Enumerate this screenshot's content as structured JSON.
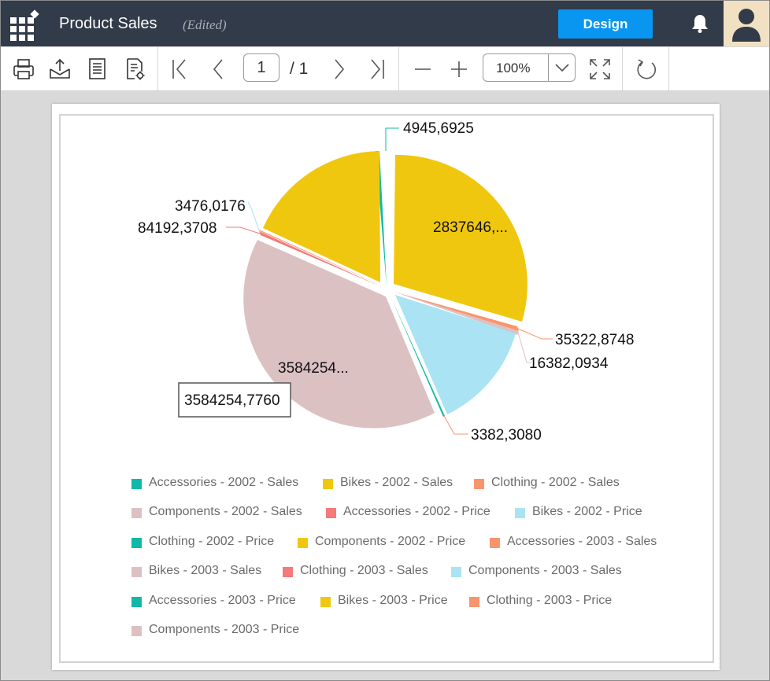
{
  "header": {
    "title": "Product Sales",
    "status": "(Edited)",
    "design_label": "Design"
  },
  "toolbar": {
    "page_value": "1",
    "page_total": "/ 1",
    "zoom": "100%"
  },
  "colors": {
    "teal": "#10b9a6",
    "yellow": "#f0c70f",
    "orange": "#f9956c",
    "pink": "#dcc1c3",
    "red": "#f47a7b",
    "lightblue": "#aae3f3",
    "topbar": "#323b49",
    "accent": "#0896f1"
  },
  "chart_data": {
    "type": "pie",
    "title": "",
    "slices": [
      {
        "series": "Accessories - 2002 - Sales",
        "value": 4945.6925,
        "label": "4945,6925",
        "color": "#10b9a6"
      },
      {
        "series": "Bikes - 2002 - Sales",
        "value": 2837646,
        "label": "2837646,...",
        "color": "#f0c70f"
      },
      {
        "series": "Clothing - 2002 - Sales",
        "value": 35322.8748,
        "label": "35322,8748",
        "color": "#f9956c"
      },
      {
        "series": "Components - 2002 - Sales",
        "value": 16382.0934,
        "label": "16382,0934",
        "color": "#dcc1c3"
      },
      {
        "series": "Components - 2003 - Sales",
        "value": 1285000,
        "label": "",
        "color": "#aae3f3"
      },
      {
        "series": "Accessories - 2003 - Price",
        "value": 3382.308,
        "label": "3382,3080",
        "color": "#10b9a6"
      },
      {
        "series": "Bikes - 2003 - Sales",
        "value": 3584254.776,
        "label": "3584254...",
        "tooltip": "3584254,7760",
        "color": "#dcc1c3"
      },
      {
        "series": "Clothing - 2003 - Sales",
        "value": 84192.3708,
        "label": "84192,3708",
        "color": "#f47a7b"
      },
      {
        "series": "Accessories - 2003 - Sales",
        "value": 3476.0176,
        "label": "3476,0176",
        "color": "#f9956c"
      },
      {
        "series": "Components - 2002 - Price",
        "value": 2000000,
        "label": "",
        "color": "#f0c70f"
      }
    ],
    "legend": [
      {
        "name": "Accessories - 2002 - Sales",
        "color": "#10b9a6"
      },
      {
        "name": "Bikes - 2002 - Sales",
        "color": "#f0c70f"
      },
      {
        "name": "Clothing - 2002 - Sales",
        "color": "#f9956c"
      },
      {
        "name": "Components - 2002 - Sales",
        "color": "#dcc1c3"
      },
      {
        "name": "Accessories - 2002 - Price",
        "color": "#f47a7b"
      },
      {
        "name": "Bikes - 2002 - Price",
        "color": "#aae3f3"
      },
      {
        "name": "Clothing - 2002 - Price",
        "color": "#10b9a6"
      },
      {
        "name": "Components - 2002 - Price",
        "color": "#f0c70f"
      },
      {
        "name": "Accessories - 2003 - Sales",
        "color": "#f9956c"
      },
      {
        "name": "Bikes - 2003 - Sales",
        "color": "#dcc1c3"
      },
      {
        "name": "Clothing - 2003 - Sales",
        "color": "#f47a7b"
      },
      {
        "name": "Components - 2003 - Sales",
        "color": "#aae3f3"
      },
      {
        "name": "Accessories - 2003 - Price",
        "color": "#10b9a6"
      },
      {
        "name": "Bikes - 2003 - Price",
        "color": "#f0c70f"
      },
      {
        "name": "Clothing - 2003 - Price",
        "color": "#f9956c"
      },
      {
        "name": "Components - 2003 - Price",
        "color": "#dcc1c3"
      }
    ],
    "legend_position": "bottom"
  }
}
